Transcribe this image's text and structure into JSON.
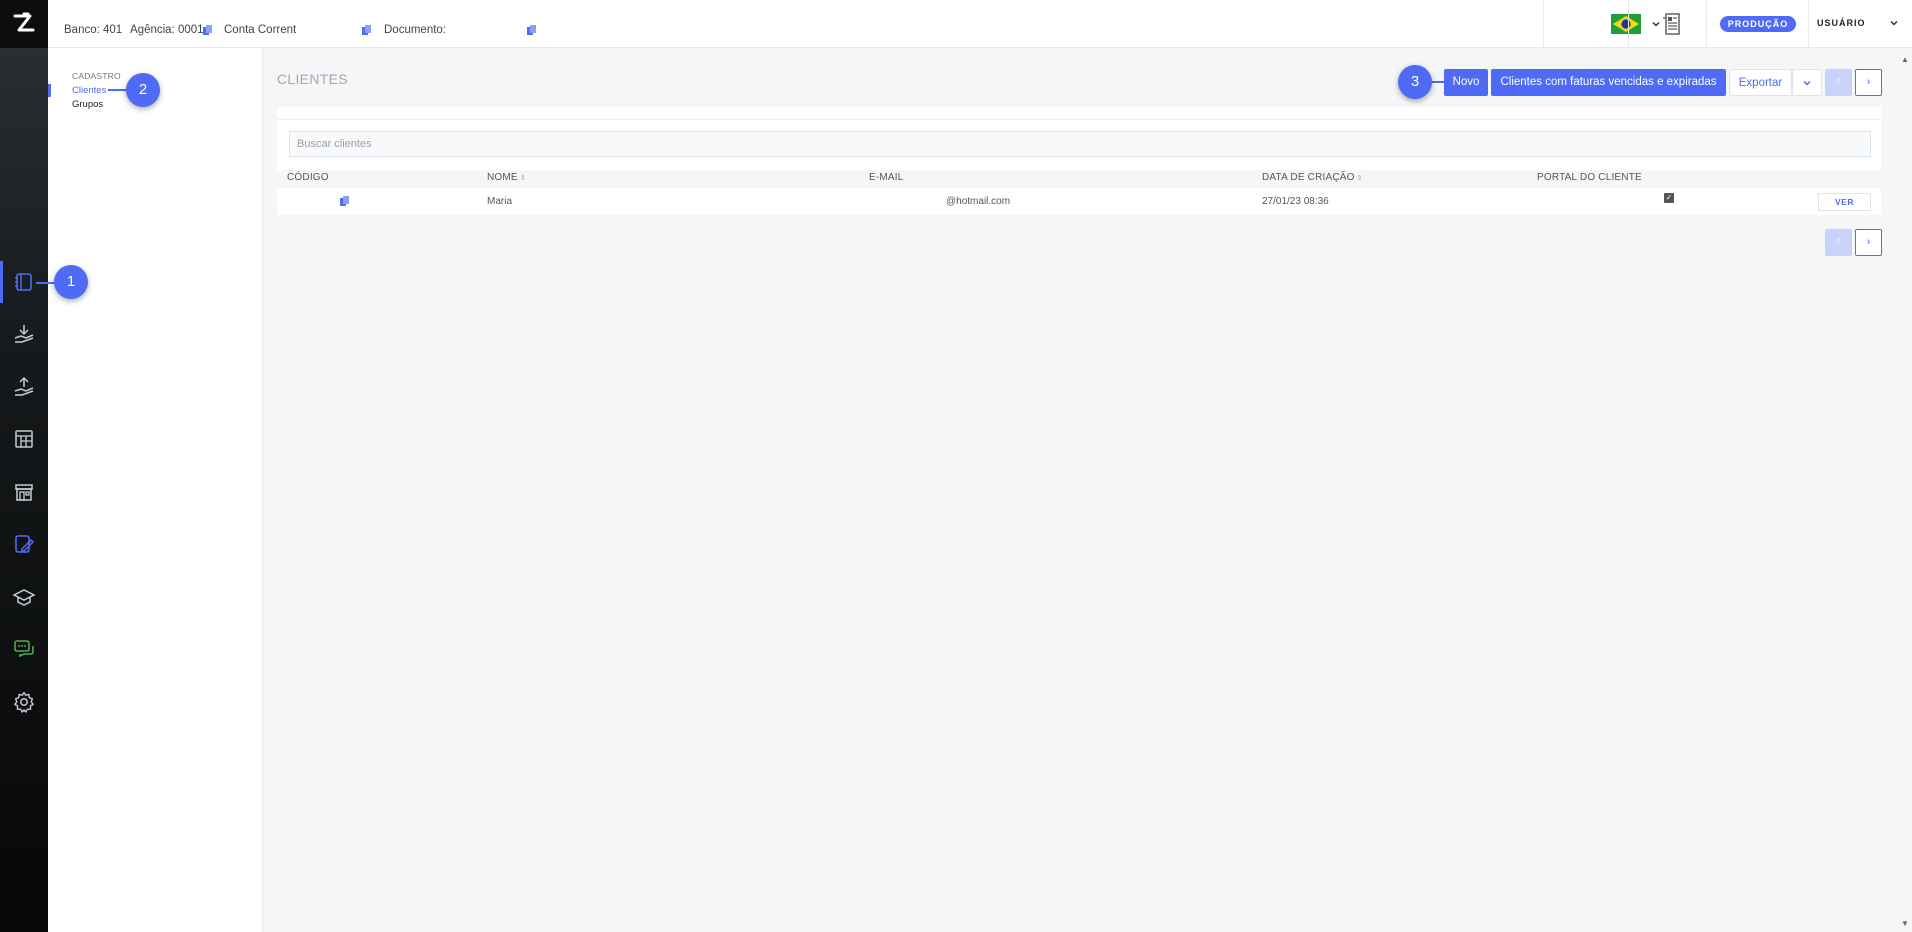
{
  "topbar": {
    "banco": "Banco: 401",
    "agencia": "Agência: 0001",
    "conta": "Conta Corrent",
    "documento": "Documento:",
    "flag_icon": "brazil-flag-icon",
    "environment_badge": "PRODUÇÃO",
    "user_label": "USUÁRIO"
  },
  "rail": {
    "items": [
      {
        "icon": "customers-icon",
        "active": true
      },
      {
        "icon": "receive-hand-icon"
      },
      {
        "icon": "pay-hand-icon"
      },
      {
        "icon": "spreadsheet-icon"
      },
      {
        "icon": "store-icon"
      },
      {
        "icon": "edit-document-icon"
      },
      {
        "icon": "education-icon"
      },
      {
        "icon": "chat-icon"
      },
      {
        "icon": "settings-icon"
      }
    ]
  },
  "subnav": {
    "section": "CADASTRO",
    "items": [
      {
        "label": "Clientes",
        "active": true
      },
      {
        "label": "Grupos"
      }
    ]
  },
  "markers": [
    "1",
    "2",
    "3"
  ],
  "main": {
    "title": "CLIENTES",
    "buttons": {
      "new": "Novo",
      "overdue": "Clientes com faturas vencidas e expiradas",
      "export": "Exportar",
      "prev": "‹",
      "next": "›"
    },
    "search_placeholder": "Buscar clientes",
    "table": {
      "columns": [
        "CÓDIGO",
        "NOME",
        "E-MAIL",
        "DATA DE CRIAÇÃO",
        "PORTAL DO CLIENTE"
      ],
      "rows": [
        {
          "nome": "Maria",
          "email": "@hotmail.com",
          "data": "27/01/23 08:36",
          "portal": true,
          "action": "VER"
        }
      ]
    }
  },
  "colors": {
    "accent": "#4f6bf5",
    "rail_dark": "#060708",
    "green_icon": "#4caf50"
  }
}
